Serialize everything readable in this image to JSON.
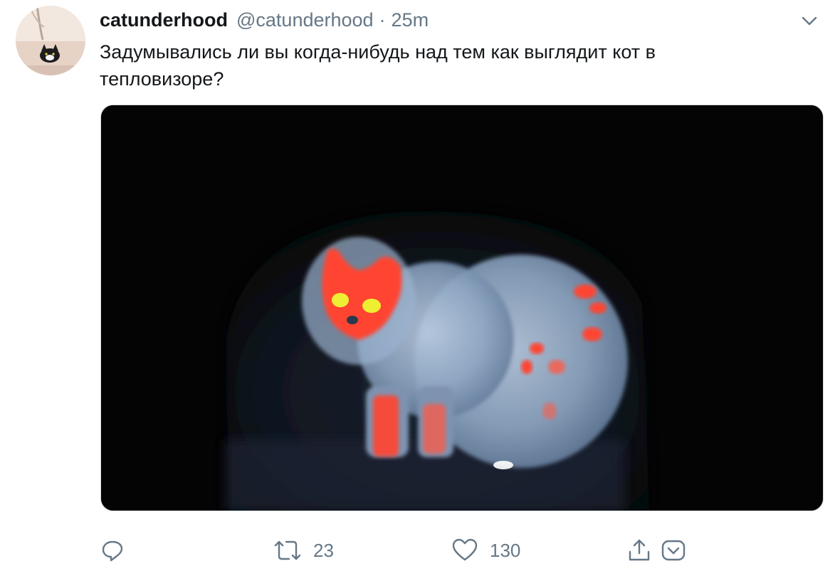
{
  "tweet": {
    "display_name": "catunderhood",
    "handle": "@catunderhood",
    "separator": "·",
    "time": "25m",
    "text": "Задумывались ли вы когда-нибудь над тем как выглядит кот в тепловизоре?",
    "media": {
      "type": "image",
      "icon": "thermal-cat-image"
    }
  },
  "actions": {
    "reply": {
      "icon": "reply-icon"
    },
    "retweet": {
      "icon": "retweet-icon",
      "count": "23"
    },
    "like": {
      "icon": "heart-icon",
      "count": "130"
    },
    "share": {
      "icon": "share-icon"
    },
    "bookmark": {
      "icon": "bookmark-icon"
    }
  },
  "colors": {
    "text": "#14171a",
    "secondary": "#657786",
    "media_background": "#050505",
    "thermal_hot": "#ff4433",
    "thermal_eyes": "#eeee33",
    "thermal_cool": "#8aa3c0"
  }
}
